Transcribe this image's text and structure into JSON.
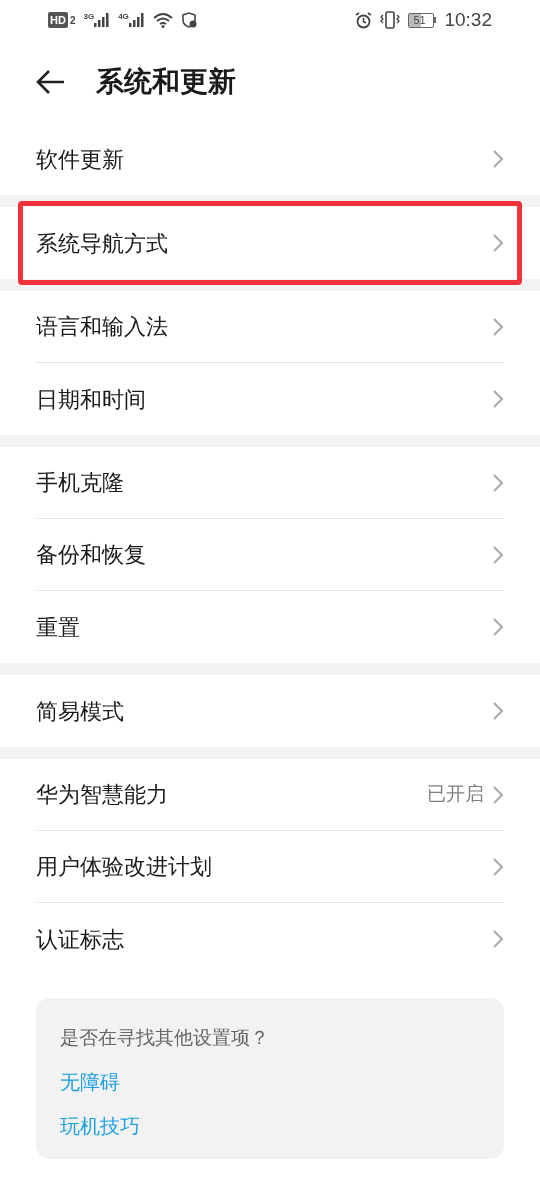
{
  "status_bar": {
    "hd": "HD",
    "sim": "2",
    "signal_1": "3G",
    "signal_2": "4G",
    "battery": "51",
    "time": "10:32"
  },
  "header": {
    "title": "系统和更新"
  },
  "groups": [
    {
      "items": [
        {
          "label": "软件更新",
          "highlighted": false
        }
      ]
    },
    {
      "items": [
        {
          "label": "系统导航方式",
          "highlighted": true
        }
      ]
    },
    {
      "items": [
        {
          "label": "语言和输入法",
          "highlighted": false
        },
        {
          "label": "日期和时间",
          "highlighted": false
        }
      ]
    },
    {
      "items": [
        {
          "label": "手机克隆",
          "highlighted": false
        },
        {
          "label": "备份和恢复",
          "highlighted": false
        },
        {
          "label": "重置",
          "highlighted": false
        }
      ]
    },
    {
      "items": [
        {
          "label": "简易模式",
          "highlighted": false
        }
      ]
    },
    {
      "items": [
        {
          "label": "华为智慧能力",
          "value": "已开启",
          "highlighted": false
        },
        {
          "label": "用户体验改进计划",
          "highlighted": false
        },
        {
          "label": "认证标志",
          "highlighted": false
        }
      ]
    }
  ],
  "suggestions": {
    "question": "是否在寻找其他设置项？",
    "links": [
      "无障碍",
      "玩机技巧"
    ]
  }
}
